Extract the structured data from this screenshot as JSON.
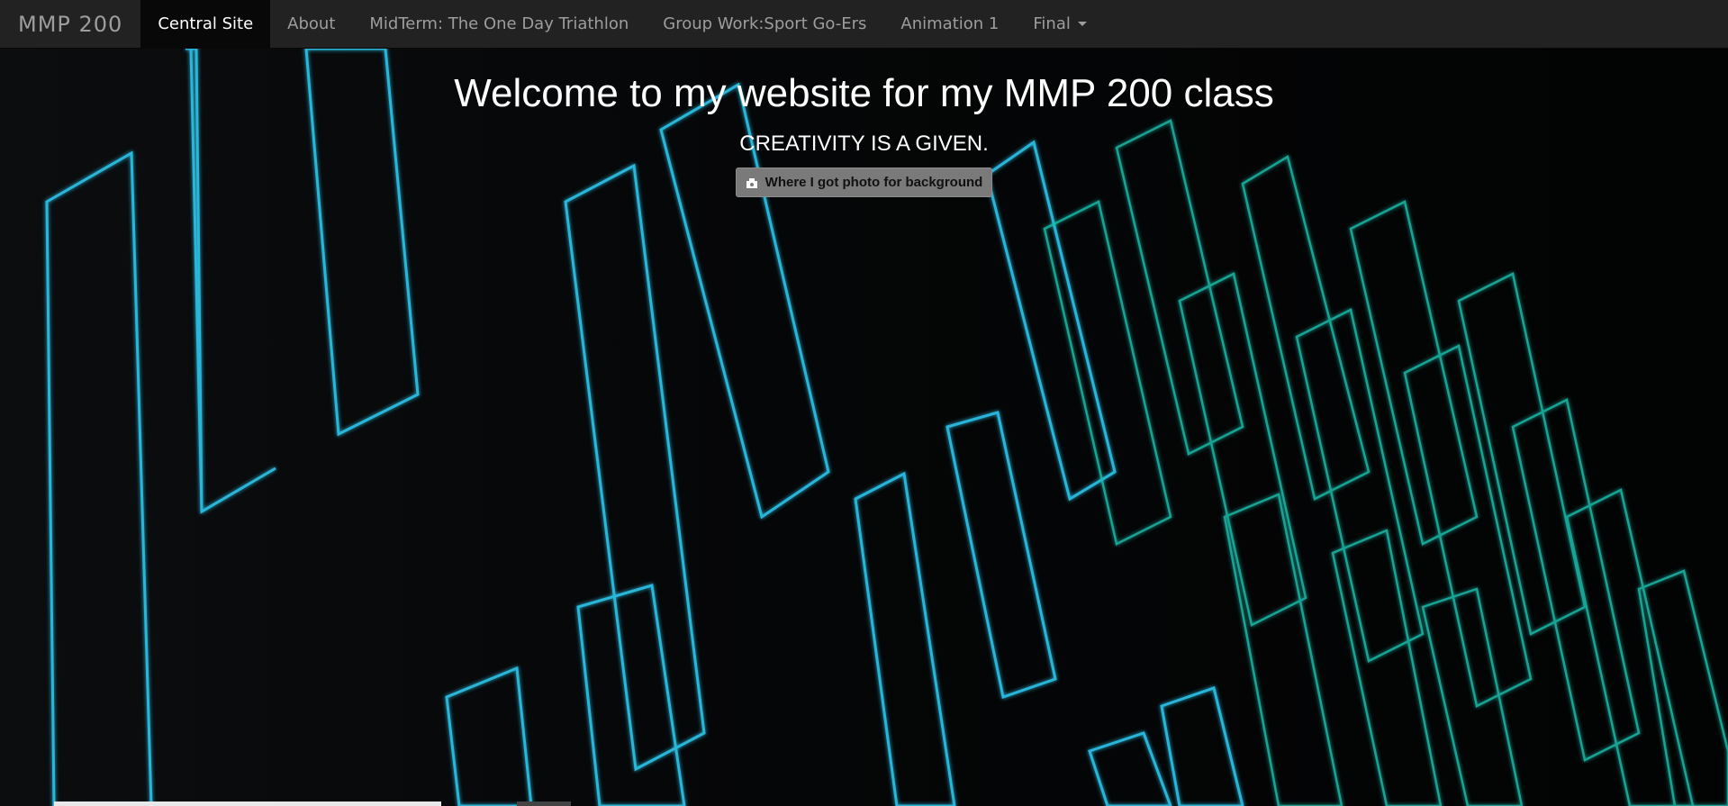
{
  "navbar": {
    "brand": "MMP 200",
    "items": [
      {
        "label": "Central Site",
        "active": true
      },
      {
        "label": "About",
        "active": false
      },
      {
        "label": "MidTerm: The One Day Triathlon",
        "active": false
      },
      {
        "label": "Group Work:Sport Go-Ers",
        "active": false
      },
      {
        "label": "Animation 1",
        "active": false
      },
      {
        "label": "Final",
        "active": false,
        "dropdown": true
      }
    ]
  },
  "hero": {
    "title": "Welcome to my website for my MMP 200 class",
    "subtitle": "CREATIVITY IS A GIVEN.",
    "credit_button": {
      "label": "Where I got photo for background",
      "icon": "camera-icon"
    }
  },
  "colors": {
    "navbar_bg": "#222222",
    "active_bg": "#080808",
    "neon": "#2ec9f0",
    "neon_teal": "#1fbfae"
  }
}
